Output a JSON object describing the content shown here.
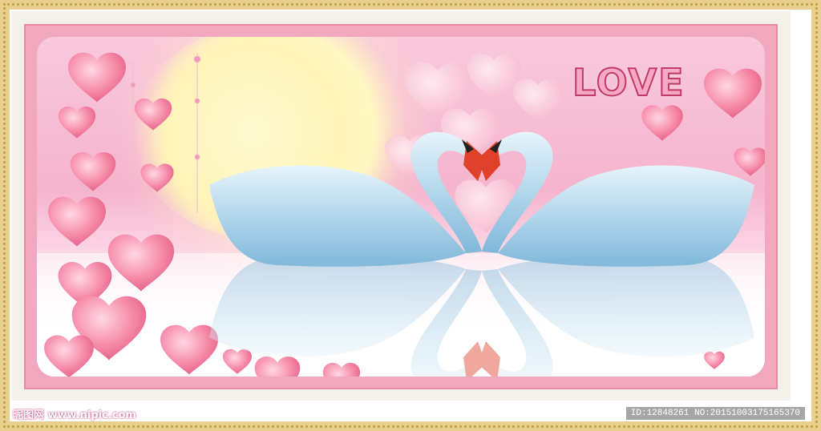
{
  "watermark": {
    "text": "昵图网 www.nipic.com"
  },
  "image_id": {
    "text": "ID:12848261 NO:20151003175165370"
  },
  "artwork": {
    "title_text": "LOVE"
  },
  "colors": {
    "frame_gold": "#e8cf8e",
    "mat": "#f4f1ea",
    "pink_border": "#f2a9bf",
    "heart": "#f68aa8",
    "swan": "#b8d8ee"
  },
  "icons": [
    "heart-icon",
    "swan-figure"
  ]
}
